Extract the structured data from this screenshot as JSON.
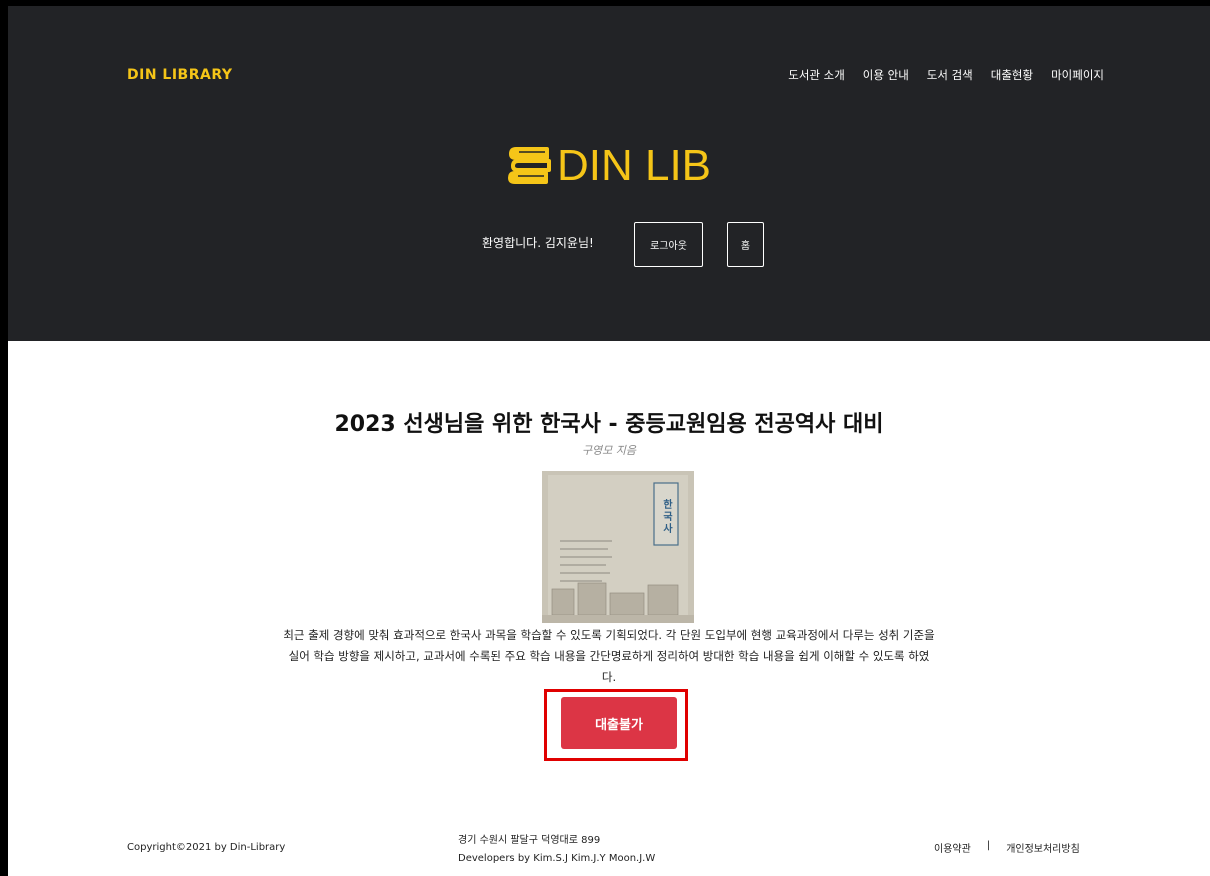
{
  "header": {
    "brand": "DIN LIBRARY",
    "nav": [
      "도서관 소개",
      "이용 안내",
      "도서 검색",
      "대출현황",
      "마이페이지"
    ],
    "logo_text": "DIN LIB",
    "logo_icon": "books-stack-icon",
    "welcome": "환영합니다. 김지윤님!",
    "logout_label": "로그아웃",
    "home_label": "홈"
  },
  "book": {
    "title": "2023 선생님을 위한 한국사 - 중등교원임용 전공역사 대비",
    "author": "구영모 지음",
    "cover_text": "한국사",
    "description": "최근 출제 경향에 맞춰 효과적으로 한국사 과목을 학습할 수 있도록 기획되었다. 각 단원 도입부에 현행 교육과정에서 다루는 성취 기준을 실어 학습 방향을 제시하고, 교과서에 수록된 주요 학습 내용을 간단명료하게 정리하여 방대한 학습 내용을 쉽게 이해할 수 있도록 하였다.",
    "loan_button": "대출불가"
  },
  "footer": {
    "copyright": "Copyright©2021 by Din-Library",
    "address": "경기 수원시 팔달구 덕영대로 899",
    "developers": "Developers by Kim.S.J Kim.J.Y Moon.J.W",
    "terms": "이용약관",
    "separator": "|",
    "privacy": "개인정보처리방침"
  },
  "colors": {
    "brand": "#f5c518",
    "hero_bg": "#222326",
    "danger": "#dc3545",
    "highlight": "#e00000"
  }
}
